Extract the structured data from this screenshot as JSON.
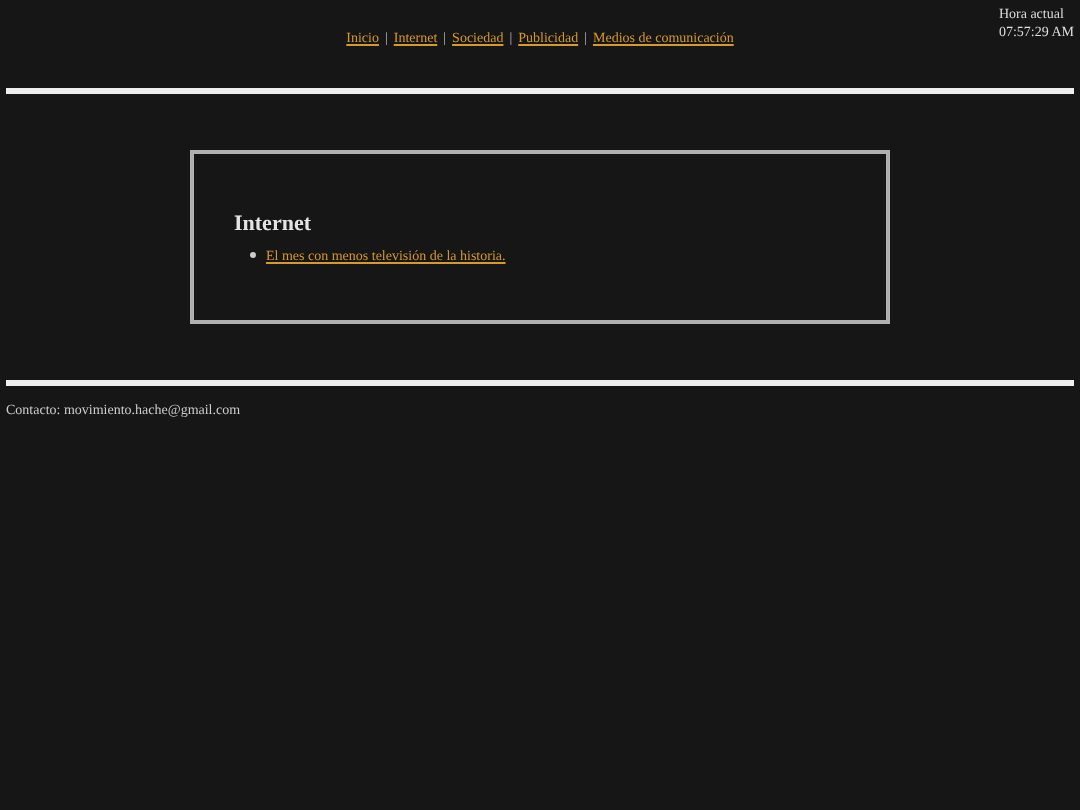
{
  "nav": [
    {
      "label": "Inicio"
    },
    {
      "separator": "|",
      "label": "Internet"
    },
    {
      "separator": "|",
      "label": "Sociedad"
    },
    {
      "separator": "|",
      "label": "Publicidad"
    },
    {
      "separator": "|",
      "label": "Medios de comunicación"
    }
  ],
  "clock": {
    "label": "Hora actual",
    "time": "07:57:29 AM"
  },
  "section": {
    "title": "Internet",
    "items": [
      "El mes con menos televisión de la historia."
    ]
  },
  "footer": {
    "contact": "Contacto: movimiento.hache@gmail.com"
  }
}
